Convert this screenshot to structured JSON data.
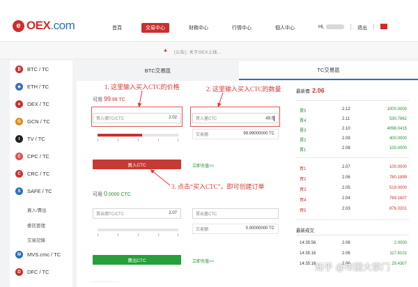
{
  "header": {
    "logo_mark": "e",
    "logo_text": "OEX",
    "logo_suffix": ".com",
    "nav": [
      "首頁",
      "交易中心",
      "財務中心",
      "行情中心",
      "個人中心"
    ],
    "active_nav": 1,
    "user_greeting": "Hi,",
    "logout": "退出"
  },
  "notice": {
    "icon": "megaphone-icon",
    "text": "[公告]: 关于OEX上线..."
  },
  "sidebar": {
    "items": [
      {
        "label": "BTC / TC",
        "icon": "btc-icon",
        "color": "#c9302c",
        "glyph": "₿"
      },
      {
        "label": "ETH / TC",
        "icon": "eth-icon",
        "color": "#3c6fb4",
        "glyph": "◆"
      },
      {
        "label": "OEX / TC",
        "icon": "oex-icon",
        "color": "#c9302c",
        "glyph": "e"
      },
      {
        "label": "GCN / TC",
        "icon": "gcn-icon",
        "color": "#e08a1a",
        "glyph": "G"
      },
      {
        "label": "TV / TC",
        "icon": "tv-icon",
        "color": "#222222",
        "glyph": "t"
      },
      {
        "label": "CPC / TC",
        "icon": "cpc-icon",
        "color": "#d9534f",
        "glyph": "C"
      },
      {
        "label": "CRC / TC",
        "icon": "crc-icon",
        "color": "#c9302c",
        "glyph": "C"
      },
      {
        "label": "SAFE / TC",
        "icon": "safe-icon",
        "color": "#2a6ebb",
        "glyph": "S"
      }
    ],
    "sub_items": [
      "買入/賣出",
      "委託管理",
      "交易記錄"
    ],
    "items2": [
      {
        "label": "MVS.cmc / TC",
        "icon": "mvs-icon",
        "color": "#2a6ebb",
        "glyph": "M"
      },
      {
        "label": "DFC / TC",
        "icon": "dfc-icon",
        "color": "#c9302c",
        "glyph": "D"
      }
    ]
  },
  "tabs": [
    {
      "label": "BTC交易區"
    },
    {
      "label": "TC交易區"
    }
  ],
  "buy_panel": {
    "available_label": "可用",
    "available_value": "99",
    "available_dec": ".99 TC",
    "price_placeholder": "買入價TC/CTC",
    "price_value": "2.02",
    "qty_placeholder": "買入量CTC",
    "qty_value": "49.5",
    "amount_label": "交易額",
    "amount_value": "99.99000000 TC",
    "slider_percent": 55,
    "button_label": "買入CTC",
    "recharge_link": "立即充值>>"
  },
  "sell_panel": {
    "available_label": "可用",
    "available_value": "0",
    "available_dec": ".0000 CTC",
    "price_placeholder": "賣出價TC/CTC",
    "price_value": "2.07",
    "qty_placeholder": "賣出量CTC",
    "amount_label": "交易額",
    "amount_value": "0.00000000 TC",
    "slider_percent": 0,
    "button_label": "賣出CTC",
    "recharge_link": "立即充值>>"
  },
  "annotations": {
    "a1": "1. 这里输入买入CTC的价格",
    "a2": "2. 这里输入买入CTC的数量",
    "a3": "3. 点击“买入CTC”，即可创建订单"
  },
  "orderbook": {
    "latest_label": "最新價:",
    "latest_price": "2.06",
    "sells": [
      {
        "label": "賣5",
        "price": "2.12",
        "qty": "1000.0000"
      },
      {
        "label": "賣4",
        "price": "2.11",
        "qty": "530.7862"
      },
      {
        "label": "賣3",
        "price": "2.10",
        "qty": "4098.0415"
      },
      {
        "label": "賣2",
        "price": "2.09",
        "qty": "400.0000"
      },
      {
        "label": "賣1",
        "price": "2.08",
        "qty": "100.0000"
      }
    ],
    "buys": [
      {
        "label": "買1",
        "price": "2.07",
        "qty": "100.0000"
      },
      {
        "label": "買2",
        "price": "2.06",
        "qty": "780.1899"
      },
      {
        "label": "買3",
        "price": "2.05",
        "qty": "519.0000"
      },
      {
        "label": "買4",
        "price": "2.04",
        "qty": "769.1607"
      },
      {
        "label": "買5",
        "price": "2.03",
        "qty": "876.0201"
      }
    ],
    "trades_label": "最新成交",
    "trades": [
      {
        "time": "14:35:56",
        "price": "2.06",
        "qty": "2.0000"
      },
      {
        "time": "14:35:16",
        "price": "2.06",
        "qty": "117.8101"
      },
      {
        "time": "14:35:16",
        "price": "2.06",
        "qty": "29.4307"
      }
    ]
  },
  "watermark": "知乎 @市国大掌门"
}
